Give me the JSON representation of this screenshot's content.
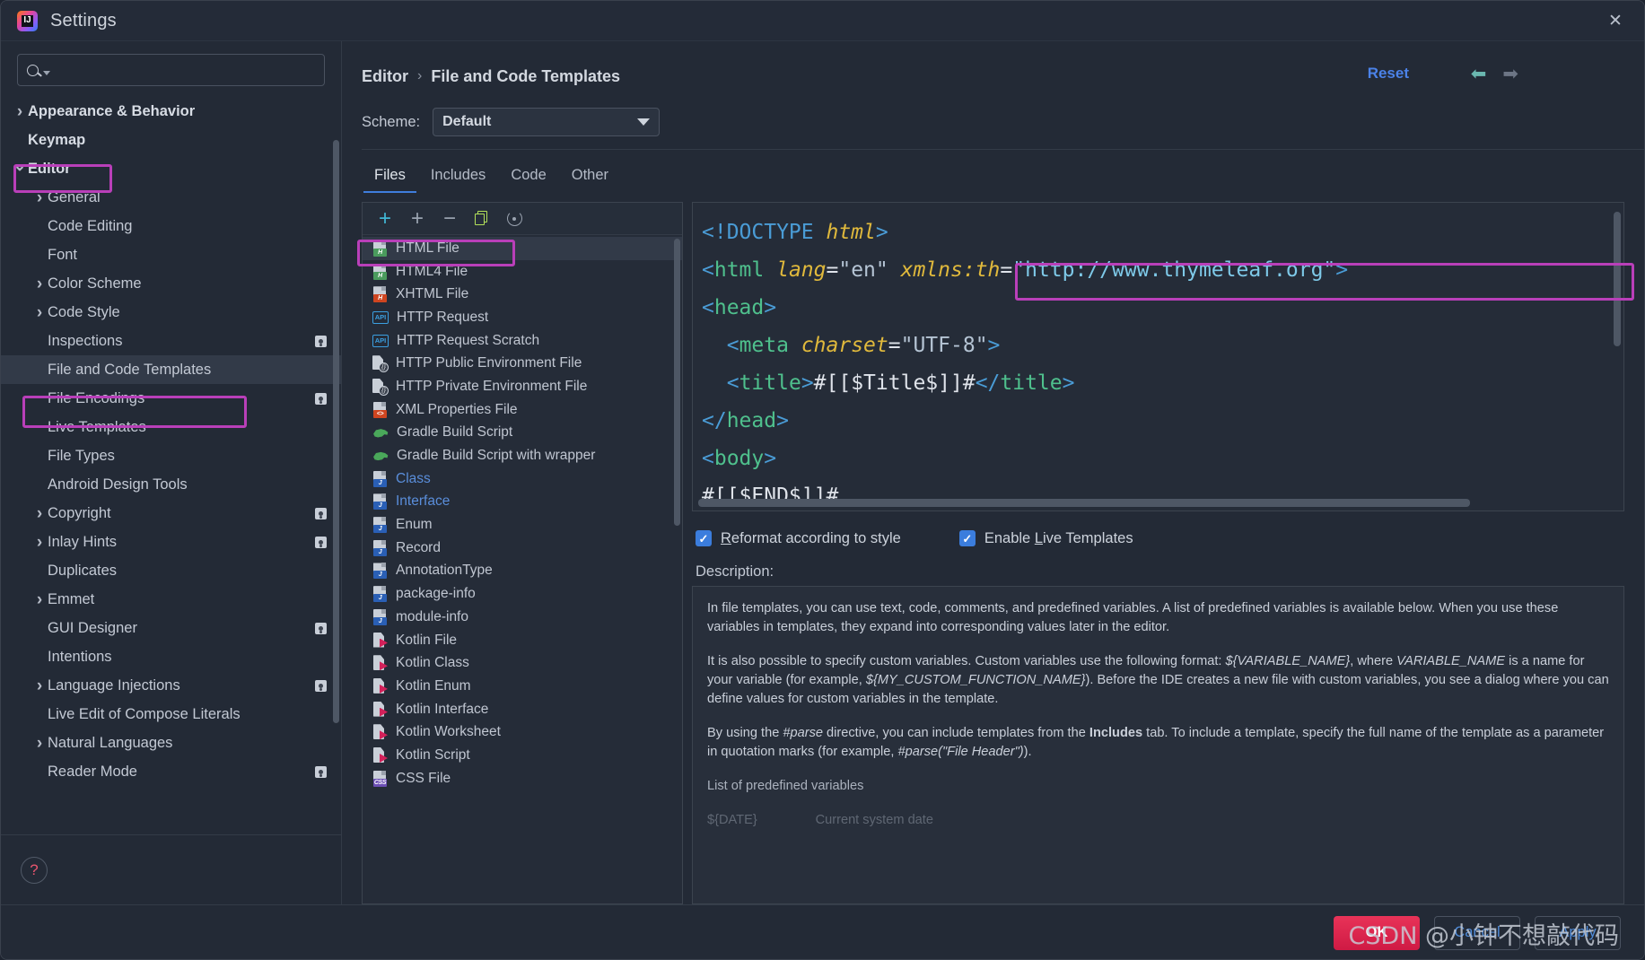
{
  "window": {
    "title": "Settings",
    "logo_icon": "intellij-idea-logo",
    "close_icon": "close-icon"
  },
  "sidebar": {
    "search": {
      "placeholder": "",
      "value": "",
      "icon": "search-icon"
    },
    "items": [
      {
        "label": "Appearance & Behavior",
        "arrow": "right",
        "indent": 0,
        "bold": true,
        "badge": false,
        "selected": false,
        "highlight": false
      },
      {
        "label": "Keymap",
        "arrow": "",
        "indent": 0,
        "bold": true,
        "badge": false,
        "selected": false,
        "highlight": false
      },
      {
        "label": "Editor",
        "arrow": "down",
        "indent": 0,
        "bold": true,
        "badge": false,
        "selected": false,
        "highlight": true
      },
      {
        "label": "General",
        "arrow": "right",
        "indent": 1,
        "bold": false,
        "badge": false,
        "selected": false,
        "highlight": false
      },
      {
        "label": "Code Editing",
        "arrow": "",
        "indent": 1,
        "bold": false,
        "badge": false,
        "selected": false,
        "highlight": false
      },
      {
        "label": "Font",
        "arrow": "",
        "indent": 1,
        "bold": false,
        "badge": false,
        "selected": false,
        "highlight": false
      },
      {
        "label": "Color Scheme",
        "arrow": "right",
        "indent": 1,
        "bold": false,
        "badge": false,
        "selected": false,
        "highlight": false
      },
      {
        "label": "Code Style",
        "arrow": "right",
        "indent": 1,
        "bold": false,
        "badge": false,
        "selected": false,
        "highlight": false
      },
      {
        "label": "Inspections",
        "arrow": "",
        "indent": 1,
        "bold": false,
        "badge": true,
        "selected": false,
        "highlight": false
      },
      {
        "label": "File and Code Templates",
        "arrow": "",
        "indent": 1,
        "bold": false,
        "badge": false,
        "selected": true,
        "highlight": true
      },
      {
        "label": "File Encodings",
        "arrow": "",
        "indent": 1,
        "bold": false,
        "badge": true,
        "selected": false,
        "highlight": false
      },
      {
        "label": "Live Templates",
        "arrow": "",
        "indent": 1,
        "bold": false,
        "badge": false,
        "selected": false,
        "highlight": false
      },
      {
        "label": "File Types",
        "arrow": "",
        "indent": 1,
        "bold": false,
        "badge": false,
        "selected": false,
        "highlight": false
      },
      {
        "label": "Android Design Tools",
        "arrow": "",
        "indent": 1,
        "bold": false,
        "badge": false,
        "selected": false,
        "highlight": false
      },
      {
        "label": "Copyright",
        "arrow": "right",
        "indent": 1,
        "bold": false,
        "badge": true,
        "selected": false,
        "highlight": false
      },
      {
        "label": "Inlay Hints",
        "arrow": "right",
        "indent": 1,
        "bold": false,
        "badge": true,
        "selected": false,
        "highlight": false
      },
      {
        "label": "Duplicates",
        "arrow": "",
        "indent": 1,
        "bold": false,
        "badge": false,
        "selected": false,
        "highlight": false
      },
      {
        "label": "Emmet",
        "arrow": "right",
        "indent": 1,
        "bold": false,
        "badge": false,
        "selected": false,
        "highlight": false
      },
      {
        "label": "GUI Designer",
        "arrow": "",
        "indent": 1,
        "bold": false,
        "badge": true,
        "selected": false,
        "highlight": false
      },
      {
        "label": "Intentions",
        "arrow": "",
        "indent": 1,
        "bold": false,
        "badge": false,
        "selected": false,
        "highlight": false
      },
      {
        "label": "Language Injections",
        "arrow": "right",
        "indent": 1,
        "bold": false,
        "badge": true,
        "selected": false,
        "highlight": false
      },
      {
        "label": "Live Edit of Compose Literals",
        "arrow": "",
        "indent": 1,
        "bold": false,
        "badge": false,
        "selected": false,
        "highlight": false
      },
      {
        "label": "Natural Languages",
        "arrow": "right",
        "indent": 1,
        "bold": false,
        "badge": false,
        "selected": false,
        "highlight": false
      },
      {
        "label": "Reader Mode",
        "arrow": "",
        "indent": 1,
        "bold": false,
        "badge": true,
        "selected": false,
        "highlight": false
      }
    ],
    "help_icon": "help-question-icon"
  },
  "header": {
    "breadcrumb": {
      "parent": "Editor",
      "separator": "›",
      "current": "File and Code Templates"
    },
    "reset_label": "Reset",
    "back_icon": "arrow-left-icon",
    "forward_icon": "arrow-right-icon"
  },
  "scheme": {
    "label": "Scheme:",
    "value": "Default",
    "dropdown_icon": "chevron-down-icon"
  },
  "tabs": [
    {
      "label": "Files",
      "active": true
    },
    {
      "label": "Includes",
      "active": false
    },
    {
      "label": "Code",
      "active": false
    },
    {
      "label": "Other",
      "active": false
    }
  ],
  "list_toolbar": [
    {
      "name": "create-template-button",
      "icon": "plus-icon-blue",
      "label": "+"
    },
    {
      "name": "add-button",
      "icon": "plus-icon",
      "label": "+"
    },
    {
      "name": "remove-button",
      "icon": "minus-icon",
      "label": "−"
    },
    {
      "name": "copy-button",
      "icon": "copy-icon",
      "label": ""
    },
    {
      "name": "reset-template-button",
      "icon": "revert-icon",
      "label": ""
    }
  ],
  "templates": [
    {
      "label": "HTML File",
      "icon": "html-file-icon",
      "tag": "H",
      "tagcolor": "green",
      "selected": true,
      "blue": false,
      "highlight": true
    },
    {
      "label": "HTML4 File",
      "icon": "html-file-icon",
      "tag": "H",
      "tagcolor": "green",
      "selected": false,
      "blue": false,
      "highlight": false
    },
    {
      "label": "XHTML File",
      "icon": "xhtml-file-icon",
      "tag": "H",
      "tagcolor": "red",
      "selected": false,
      "blue": false,
      "highlight": false
    },
    {
      "label": "HTTP Request",
      "icon": "api-icon",
      "tag": "API",
      "tagcolor": "api",
      "selected": false,
      "blue": false,
      "highlight": false
    },
    {
      "label": "HTTP Request Scratch",
      "icon": "api-icon",
      "tag": "API",
      "tagcolor": "api",
      "selected": false,
      "blue": false,
      "highlight": false
    },
    {
      "label": "HTTP Public Environment File",
      "icon": "env-file-icon",
      "tag": "{}",
      "tagcolor": "env",
      "selected": false,
      "blue": false,
      "highlight": false
    },
    {
      "label": "HTTP Private Environment File",
      "icon": "env-file-icon",
      "tag": "{}",
      "tagcolor": "env",
      "selected": false,
      "blue": false,
      "highlight": false
    },
    {
      "label": "XML Properties File",
      "icon": "xml-file-icon",
      "tag": "<>",
      "tagcolor": "red",
      "selected": false,
      "blue": false,
      "highlight": false
    },
    {
      "label": "Gradle Build Script",
      "icon": "gradle-icon",
      "tag": "",
      "tagcolor": "gradle",
      "selected": false,
      "blue": false,
      "highlight": false
    },
    {
      "label": "Gradle Build Script with wrapper",
      "icon": "gradle-icon",
      "tag": "",
      "tagcolor": "gradle",
      "selected": false,
      "blue": false,
      "highlight": false
    },
    {
      "label": "Class",
      "icon": "java-file-icon",
      "tag": "J",
      "tagcolor": "blue",
      "selected": false,
      "blue": true,
      "highlight": false
    },
    {
      "label": "Interface",
      "icon": "java-file-icon",
      "tag": "J",
      "tagcolor": "blue",
      "selected": false,
      "blue": true,
      "highlight": false
    },
    {
      "label": "Enum",
      "icon": "java-file-icon",
      "tag": "J",
      "tagcolor": "blue",
      "selected": false,
      "blue": false,
      "highlight": false
    },
    {
      "label": "Record",
      "icon": "java-file-icon",
      "tag": "J",
      "tagcolor": "blue",
      "selected": false,
      "blue": false,
      "highlight": false
    },
    {
      "label": "AnnotationType",
      "icon": "java-file-icon",
      "tag": "J",
      "tagcolor": "blue",
      "selected": false,
      "blue": false,
      "highlight": false
    },
    {
      "label": "package-info",
      "icon": "java-file-icon",
      "tag": "J",
      "tagcolor": "blue",
      "selected": false,
      "blue": false,
      "highlight": false
    },
    {
      "label": "module-info",
      "icon": "java-file-icon",
      "tag": "J",
      "tagcolor": "blue",
      "selected": false,
      "blue": false,
      "highlight": false
    },
    {
      "label": "Kotlin File",
      "icon": "kotlin-file-icon",
      "tag": "",
      "tagcolor": "kotlin",
      "selected": false,
      "blue": false,
      "highlight": false
    },
    {
      "label": "Kotlin Class",
      "icon": "kotlin-file-icon",
      "tag": "",
      "tagcolor": "kotlin",
      "selected": false,
      "blue": false,
      "highlight": false
    },
    {
      "label": "Kotlin Enum",
      "icon": "kotlin-file-icon",
      "tag": "",
      "tagcolor": "kotlin",
      "selected": false,
      "blue": false,
      "highlight": false
    },
    {
      "label": "Kotlin Interface",
      "icon": "kotlin-file-icon",
      "tag": "",
      "tagcolor": "kotlin",
      "selected": false,
      "blue": false,
      "highlight": false
    },
    {
      "label": "Kotlin Worksheet",
      "icon": "kotlin-file-icon",
      "tag": "",
      "tagcolor": "kotlin",
      "selected": false,
      "blue": false,
      "highlight": false
    },
    {
      "label": "Kotlin Script",
      "icon": "kotlin-file-icon",
      "tag": "",
      "tagcolor": "kotlin",
      "selected": false,
      "blue": false,
      "highlight": false
    },
    {
      "label": "CSS File",
      "icon": "css-file-icon",
      "tag": "CSS",
      "tagcolor": "purple",
      "selected": false,
      "blue": false,
      "highlight": false
    }
  ],
  "editor": {
    "lines": [
      "<!DOCTYPE html>",
      "<html lang=\"en\" xmlns:th=\"http://www.thymeleaf.org\">",
      "<head>",
      "  <meta charset=\"UTF-8\">",
      "  <title>#[[$Title$]]#</title>",
      "</head>",
      "<body>",
      "#[[$END$]]#"
    ],
    "highlighted_fragment": "xmlns:th=\"http://www.thymeleaf.org\""
  },
  "options": {
    "reformat": {
      "label": "Reformat according to style",
      "mnemonic": "R",
      "checked": true
    },
    "live_templates": {
      "label": "Enable Live Templates",
      "mnemonic": "L",
      "checked": true
    }
  },
  "description": {
    "label": "Description:",
    "p1": "In file templates, you can use text, code, comments, and predefined variables. A list of predefined variables is available below. When you use these variables in templates, they expand into corresponding values later in the editor.",
    "p2_a": "It is also possible to specify custom variables. Custom variables use the following format: ",
    "p2_var1": "${VARIABLE_NAME}",
    "p2_b": ", where ",
    "p2_var2": "VARIABLE_NAME",
    "p2_c": " is a name for your variable (for example, ",
    "p2_var3": "${MY_CUSTOM_FUNCTION_NAME}",
    "p2_d": "). Before the IDE creates a new file with custom variables, you see a dialog where you can define values for custom variables in the template.",
    "p3_a": "By using the ",
    "p3_directive": "#parse",
    "p3_b": " directive, you can include templates from the ",
    "p3_bold": "Includes",
    "p3_c": " tab. To include a template, specify the full name of the template as a parameter in quotation marks (for example, ",
    "p3_example": "#parse(\"File Header\")",
    "p3_d": ").",
    "list_header": "List of predefined variables",
    "cut_var": "${DATE}",
    "cut_desc": "Current system date"
  },
  "footer": {
    "ok": "OK",
    "cancel": "Cancel",
    "apply": "Apply"
  },
  "watermark": "CSDN @小钟不想敲代码",
  "colors": {
    "accent_blue": "#3b7ddd",
    "annotation_pink": "#b93fb9",
    "ok_red": "#e83358",
    "link_blue": "#4b82e8",
    "background": "#232a36"
  }
}
